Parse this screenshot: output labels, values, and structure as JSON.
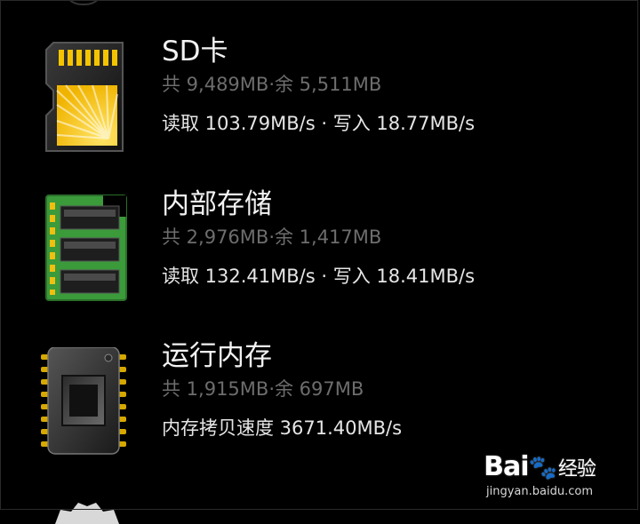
{
  "storage_items": [
    {
      "title": "SD卡",
      "capacity": "共 9,489MB·余 5,511MB",
      "speed": "读取 103.79MB/s · 写入 18.77MB/s",
      "icon": "sd-card-icon"
    },
    {
      "title": "内部存储",
      "capacity": "共 2,976MB·余 1,417MB",
      "speed": "读取 132.41MB/s · 写入 18.41MB/s",
      "icon": "memory-module-icon"
    },
    {
      "title": "运行内存",
      "capacity": "共 1,915MB·余 697MB",
      "speed": "内存拷贝速度 3671.40MB/s",
      "icon": "ram-chip-icon"
    }
  ],
  "watermark": {
    "logo_bai": "Bai",
    "logo_paw": "🐾",
    "logo_jing": "经验",
    "url": "jingyan.baidu.com"
  },
  "colors": {
    "background": "#000000",
    "title": "#f2f2f2",
    "capacity": "#6d6d6d",
    "speed": "#e6e6e6",
    "sd_card_gold": "#f5c400",
    "pcb_green": "#3b9a3a"
  }
}
